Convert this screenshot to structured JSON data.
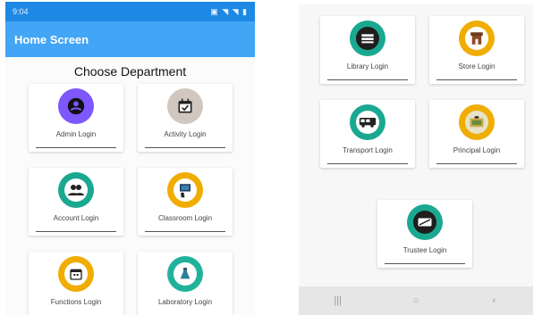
{
  "left_screen": {
    "status_bar": {
      "time": "9:04",
      "icons_right": "▣ ◥ ◥ ▮"
    },
    "app_bar_title": "Home Screen",
    "heading": "Choose Department",
    "cards": [
      {
        "label": "Admin Login",
        "icon": "person-icon",
        "color": "#7e57ff"
      },
      {
        "label": "Activity Login",
        "icon": "calendar-check-icon",
        "color": "#d2c7be"
      },
      {
        "label": "Account Login",
        "icon": "people-icon",
        "color": "#1aa890"
      },
      {
        "label": "Classroom Login",
        "icon": "classroom-icon",
        "color": "#f0ad00"
      },
      {
        "label": "Functions Login",
        "icon": "calendar-icon",
        "color": "#f0ad00"
      },
      {
        "label": "Laboratory Login",
        "icon": "lab-icon",
        "color": "#20b39a"
      }
    ]
  },
  "right_screen": {
    "cards": [
      {
        "label": "Library Login",
        "icon": "books-icon",
        "color": "#1aa890"
      },
      {
        "label": "Store Login",
        "icon": "store-icon",
        "color": "#f0ad00"
      },
      {
        "label": "Transport Login",
        "icon": "bus-icon",
        "color": "#1aa890"
      },
      {
        "label": "Principal Login",
        "icon": "principal-icon",
        "color": "#f0ad00"
      },
      {
        "label": "Trustee Login",
        "icon": "trustee-icon",
        "color": "#1aa890"
      }
    ],
    "nav_bar": {
      "recents": "|||",
      "home": "○",
      "back": "‹"
    }
  }
}
